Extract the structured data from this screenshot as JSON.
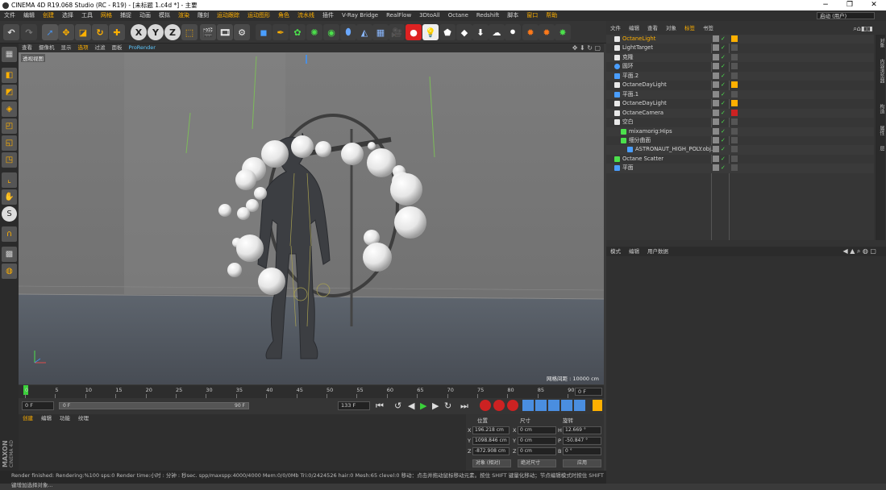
{
  "window": {
    "title": "CINEMA 4D R19.068 Studio (RC - R19) - [未标题 1.c4d *] - 主要",
    "controls": [
      "−",
      "❐",
      "✕"
    ]
  },
  "menubar": {
    "items": [
      "文件",
      "编辑",
      "创建",
      "选择",
      "工具",
      "网格",
      "捕捉",
      "动画",
      "模拟",
      "渲染",
      "雕刻",
      "运动跟踪",
      "运动图形",
      "角色",
      "流水线",
      "插件",
      "V-Ray Bridge",
      "RealFlow",
      "3DtoAll",
      "Octane",
      "Redshift",
      "脚本",
      "窗口",
      "帮助"
    ],
    "interface_label": "界面:",
    "interface_value": "启动 (用户)"
  },
  "toolbar": {
    "axis_labels": [
      "X",
      "Y",
      "Z"
    ],
    "icons": [
      "undo-icon",
      "redo-icon",
      "live-select-icon",
      "move-icon",
      "scale-icon",
      "rotate-icon",
      "recent-tool-icon",
      "x-axis-icon",
      "y-axis-icon",
      "z-axis-icon",
      "coordinate-system-icon",
      "render-view-icon",
      "render-picture-viewer-icon",
      "edit-render-settings-icon",
      "cube-icon",
      "pen-icon",
      "subdivision-icon",
      "array-icon",
      "deformer-icon",
      "plane-icon",
      "floor-icon",
      "camera-icon",
      "record-icon",
      "light-icon",
      "sky-icon",
      "terrain-icon",
      "arrow-down-icon",
      "cloud-icon",
      "octane-camera-icon",
      "octane-render-icon",
      "octane-settings-icon",
      "octane-live-icon"
    ]
  },
  "viewport": {
    "menu": [
      "查看",
      "摄像机",
      "显示",
      "选项",
      "过滤",
      "面板",
      "ProRender"
    ],
    "label": "透视视图",
    "grid_spacing": "网格间距 : 10000 cm"
  },
  "timeline": {
    "ticks": [
      "0",
      "5",
      "10",
      "15",
      "20",
      "25",
      "30",
      "35",
      "40",
      "45",
      "50",
      "55",
      "60",
      "65",
      "70",
      "75",
      "80",
      "85",
      "90"
    ],
    "current_frame_field": "0 F"
  },
  "transport": {
    "start_field": "0 F",
    "range_start": "0 F",
    "range_end": "90 F",
    "end_field": "133 F"
  },
  "material_manager": {
    "tabs": [
      "创建",
      "编辑",
      "功能",
      "纹理"
    ],
    "logo_top": "MAXON",
    "logo_bottom": "CINEMA 4D"
  },
  "coordinates": {
    "headers": [
      "位置",
      "尺寸",
      "旋转"
    ],
    "rows": [
      {
        "axis": "X",
        "pos": "196.218 cm",
        "size_axis": "X",
        "size": "0 cm",
        "rot_axis": "H",
        "rot": "12.669 °"
      },
      {
        "axis": "Y",
        "pos": "1098.846 cm",
        "size_axis": "Y",
        "size": "0 cm",
        "rot_axis": "P",
        "rot": "-50.847 °"
      },
      {
        "axis": "Z",
        "pos": "-872.908 cm",
        "size_axis": "Z",
        "size": "0 cm",
        "rot_axis": "B",
        "rot": "0 °"
      }
    ],
    "mode_select": "对象 (相对)",
    "size_select": "绝对尺寸",
    "apply_button": "应用"
  },
  "status": {
    "text": "Render finished: Rendering:%100 sps:0 Render time:小时 : 分钟 : 秒sec. spp/maxspp:4000/4000 Mem:0/0/0Mb Tri:0/2424526 hair:0 Mesh:65 clevel:0      移动：点击并拖动鼠标移动元素。按住 SHIFT 键量化移动；节点编辑模式时按住 SHIFT 键增加选择对象..."
  },
  "object_manager": {
    "tabs": [
      "文件",
      "编辑",
      "查看",
      "对象",
      "标签",
      "书签"
    ],
    "objects": [
      {
        "name": "OctaneLight",
        "highlight": true,
        "indent": 0,
        "icon": "light-icon"
      },
      {
        "name": "LightTarget",
        "highlight": false,
        "indent": 0,
        "icon": "target-icon"
      },
      {
        "name": "克隆",
        "highlight": false,
        "indent": 0,
        "icon": "cloner-icon"
      },
      {
        "name": "圆环",
        "highlight": false,
        "indent": 0,
        "icon": "circle-icon"
      },
      {
        "name": "平面.2",
        "highlight": false,
        "indent": 0,
        "icon": "plane-icon"
      },
      {
        "name": "OctaneDayLight",
        "highlight": false,
        "indent": 0,
        "icon": "daylight-icon"
      },
      {
        "name": "平面.1",
        "highlight": false,
        "indent": 0,
        "icon": "plane-icon"
      },
      {
        "name": "OctaneDayLight",
        "highlight": false,
        "indent": 0,
        "icon": "daylight-icon"
      },
      {
        "name": "OctaneCamera",
        "highlight": false,
        "indent": 0,
        "icon": "camera-icon"
      },
      {
        "name": "空白",
        "highlight": false,
        "indent": 0,
        "icon": "null-icon"
      },
      {
        "name": "mixamorig:Hips",
        "highlight": false,
        "indent": 1,
        "icon": "joint-icon"
      },
      {
        "name": "细分曲面",
        "highlight": false,
        "indent": 1,
        "icon": "subdivision-icon"
      },
      {
        "name": "ASTRONAUT_HIGH_POLY.obj.1",
        "highlight": false,
        "indent": 2,
        "icon": "polygon-icon"
      },
      {
        "name": "Octane Scatter",
        "highlight": false,
        "indent": 0,
        "icon": "scatter-icon"
      },
      {
        "name": "平面",
        "highlight": false,
        "indent": 0,
        "icon": "plane-icon"
      }
    ]
  },
  "attribute_manager": {
    "tabs": [
      "模式",
      "编辑",
      "用户数据"
    ]
  },
  "side_tabs": [
    "对象",
    "内容浏览器",
    "构造",
    "属性",
    "层"
  ],
  "colors": {
    "highlight_text": "#ffb000",
    "accent_blue": "#4a8ee0",
    "viewport_bg": "#7a7a7a",
    "floor": "#545c66"
  }
}
